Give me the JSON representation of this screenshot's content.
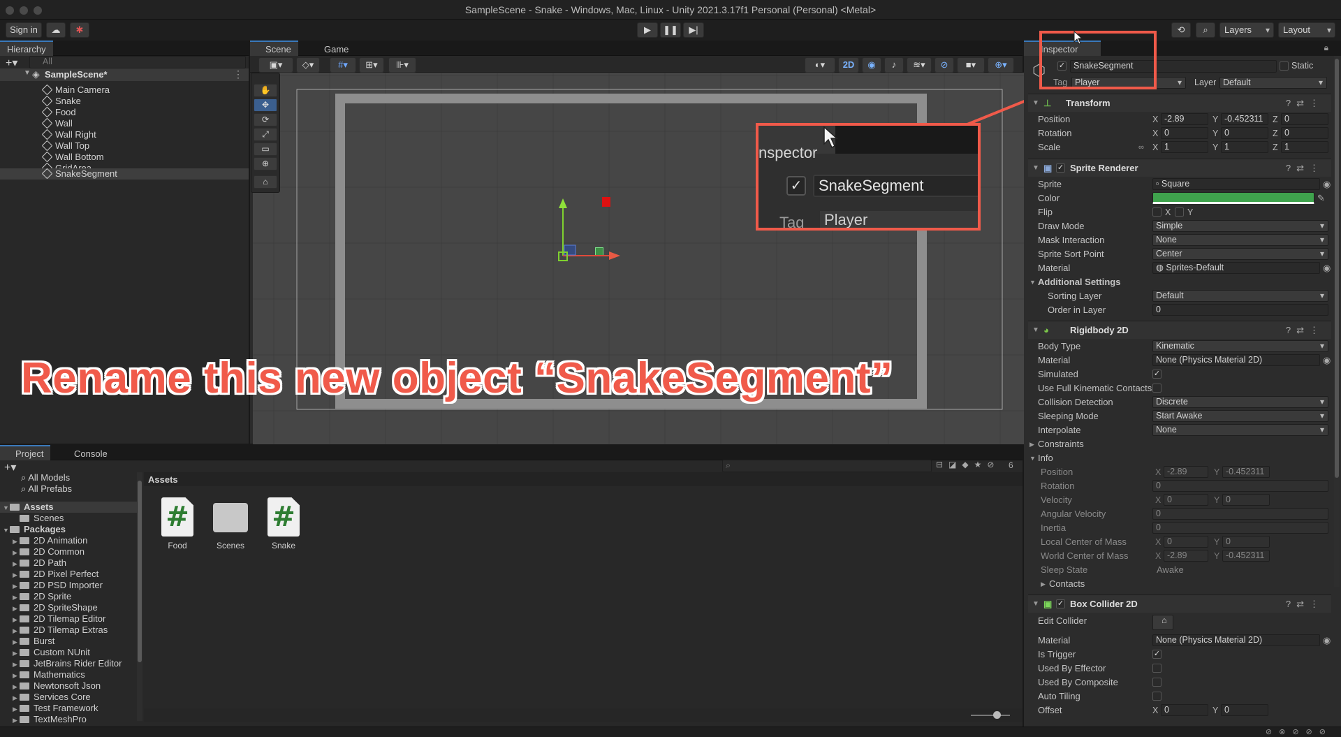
{
  "window": {
    "title": "SampleScene - Snake - Windows, Mac, Linux - Unity 2021.3.17f1 Personal (Personal) <Metal>"
  },
  "toolbar": {
    "sign_in": "Sign in",
    "layers": "Layers",
    "layout": "Layout"
  },
  "hierarchy": {
    "tab": "Hierarchy",
    "search_placeholder": "All",
    "scene": "SampleScene*",
    "items": [
      "Main Camera",
      "Snake",
      "Food",
      "Wall",
      "Wall Right",
      "Wall Top",
      "Wall Bottom",
      "GridArea",
      "SnakeSegment"
    ]
  },
  "scene_tabs": {
    "scene": "Scene",
    "game": "Game",
    "mode_2d": "2D"
  },
  "annotation": {
    "caption": "Rename this new object “SnakeSegment”",
    "zoom_inspector": "nspector",
    "zoom_name": "SnakeSegment",
    "zoom_tag_label": "Tag",
    "zoom_tag": "Player"
  },
  "inspector": {
    "tab": "Inspector",
    "name": "SnakeSegment",
    "static": "Static",
    "tag_label": "Tag",
    "tag": "Player",
    "layer_label": "Layer",
    "layer": "Default",
    "transform": {
      "title": "Transform",
      "position_label": "Position",
      "position": [
        "-2.89",
        "-0.452311",
        "0"
      ],
      "rotation_label": "Rotation",
      "rotation": [
        "0",
        "0",
        "0"
      ],
      "scale_label": "Scale",
      "scale": [
        "1",
        "1",
        "1"
      ]
    },
    "sprite_renderer": {
      "title": "Sprite Renderer",
      "sprite_label": "Sprite",
      "sprite": "Square",
      "color_label": "Color",
      "color": "#3fa34d",
      "flip_label": "Flip",
      "flip_x": "X",
      "flip_y": "Y",
      "draw_mode_label": "Draw Mode",
      "draw_mode": "Simple",
      "mask_label": "Mask Interaction",
      "mask": "None",
      "sort_point_label": "Sprite Sort Point",
      "sort_point": "Center",
      "material_label": "Material",
      "material": "Sprites-Default",
      "additional": "Additional Settings",
      "sorting_layer_label": "Sorting Layer",
      "sorting_layer": "Default",
      "order_label": "Order in Layer",
      "order": "0"
    },
    "rigidbody": {
      "title": "Rigidbody 2D",
      "body_type_label": "Body Type",
      "body_type": "Kinematic",
      "material_label": "Material",
      "material": "None (Physics Material 2D)",
      "simulated_label": "Simulated",
      "full_kin_label": "Use Full Kinematic Contacts",
      "collision_label": "Collision Detection",
      "collision": "Discrete",
      "sleeping_label": "Sleeping Mode",
      "sleeping": "Start Awake",
      "interpolate_label": "Interpolate",
      "interpolate": "None",
      "constraints": "Constraints",
      "info": "Info",
      "info_position_label": "Position",
      "info_position": [
        "-2.89",
        "-0.452311"
      ],
      "info_rotation_label": "Rotation",
      "info_rotation": "0",
      "velocity_label": "Velocity",
      "velocity": [
        "0",
        "0"
      ],
      "ang_vel_label": "Angular Velocity",
      "ang_vel": "0",
      "inertia_label": "Inertia",
      "inertia": "0",
      "local_com_label": "Local Center of Mass",
      "local_com": [
        "0",
        "0"
      ],
      "world_com_label": "World Center of Mass",
      "world_com": [
        "-2.89",
        "-0.452311"
      ],
      "sleep_state_label": "Sleep State",
      "sleep_state": "Awake",
      "contacts": "Contacts"
    },
    "box_collider": {
      "title": "Box Collider 2D",
      "edit_label": "Edit Collider",
      "material_label": "Material",
      "material": "None (Physics Material 2D)",
      "trigger_label": "Is Trigger",
      "effector_label": "Used By Effector",
      "composite_label": "Used By Composite",
      "tiling_label": "Auto Tiling",
      "offset_label": "Offset",
      "offset": [
        "0",
        "0"
      ]
    }
  },
  "project": {
    "tab": "Project",
    "console_tab": "Console",
    "favorites": [
      "All Models",
      "All Prefabs"
    ],
    "assets_label": "Assets",
    "scenes": "Scenes",
    "packages_label": "Packages",
    "packages": [
      "2D Animation",
      "2D Common",
      "2D Path",
      "2D Pixel Perfect",
      "2D PSD Importer",
      "2D Sprite",
      "2D SpriteShape",
      "2D Tilemap Editor",
      "2D Tilemap Extras",
      "Burst",
      "Custom NUnit",
      "JetBrains Rider Editor",
      "Mathematics",
      "Newtonsoft Json",
      "Services Core",
      "Test Framework",
      "TextMeshPro"
    ],
    "breadcrumb": "Assets",
    "assets": [
      "Food",
      "Scenes",
      "Snake"
    ],
    "hidden_count": "6"
  },
  "colors": {
    "accent": "#3a79bb",
    "highlight_box": "#f05a4a",
    "sprite_color": "#3fa34d"
  }
}
